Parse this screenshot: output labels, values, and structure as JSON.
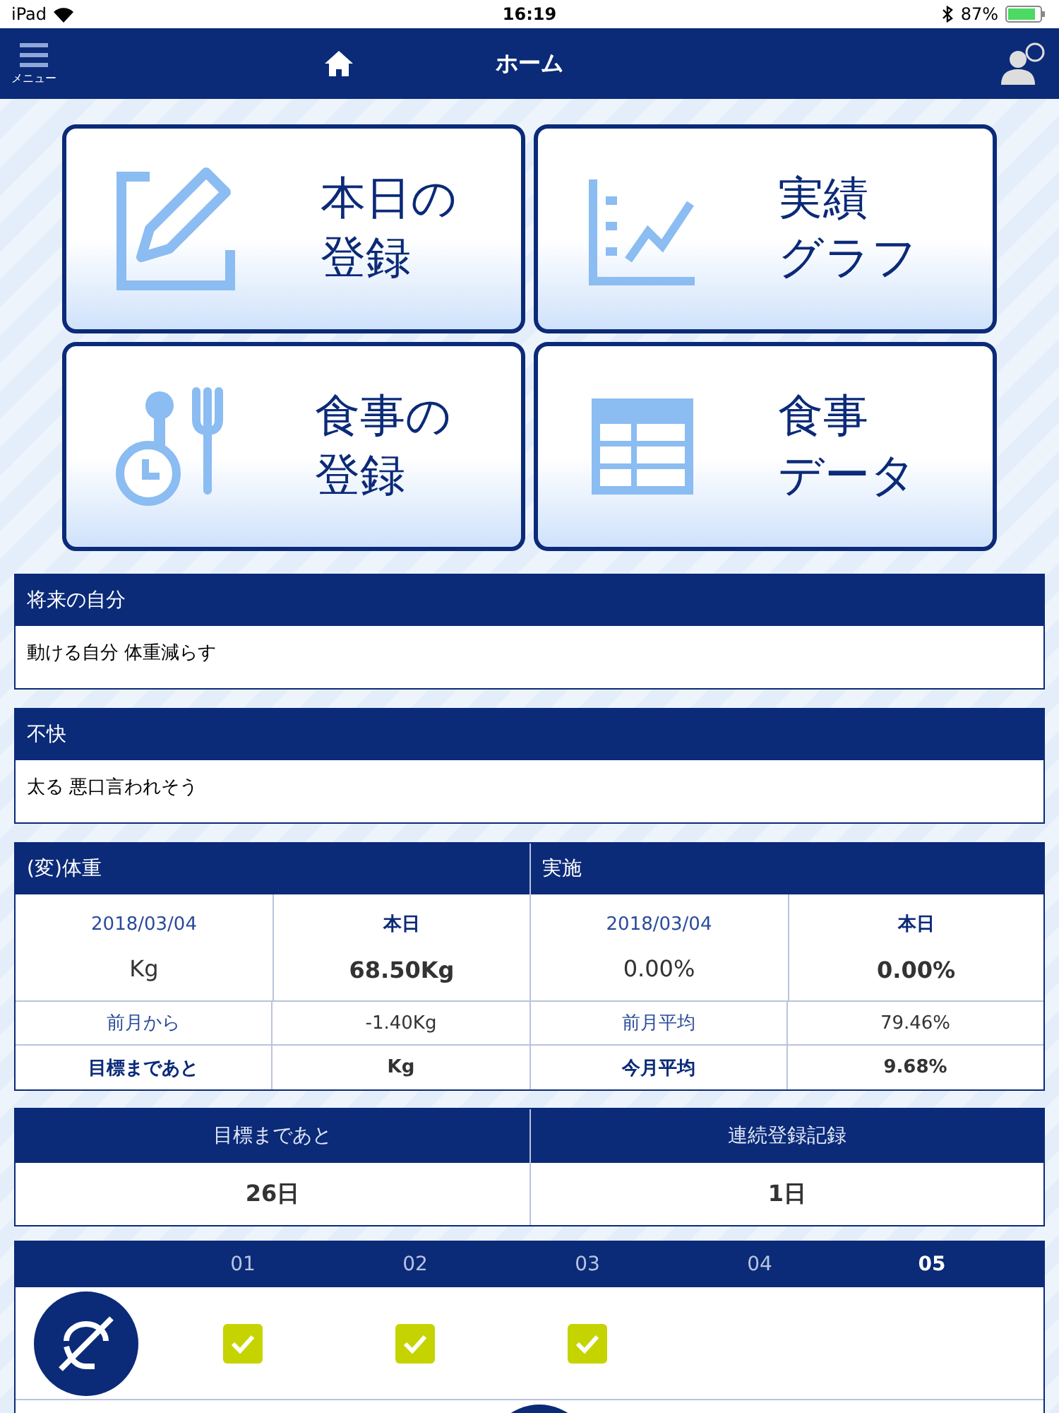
{
  "status_bar": {
    "device": "iPad",
    "time": "16:19",
    "battery": "87%"
  },
  "nav": {
    "menu_label": "メニュー",
    "title": "ホーム"
  },
  "tiles": [
    {
      "kind": "edit",
      "lines": [
        "本日の",
        "登録"
      ]
    },
    {
      "kind": "graph",
      "lines": [
        "実績",
        "グラフ"
      ]
    },
    {
      "kind": "meal",
      "lines": [
        "食事の",
        "登録"
      ]
    },
    {
      "kind": "table",
      "lines": [
        "食事",
        "データ"
      ]
    }
  ],
  "notes": [
    {
      "title": "将来の自分",
      "body": "動ける自分 体重減らす"
    },
    {
      "title": "不快",
      "body": "太る 悪口言われそう"
    }
  ],
  "stats": [
    {
      "title": "(変)体重",
      "date": "2018/03/04",
      "today_label": "本日",
      "past_value": "Kg",
      "today_value": "68.50Kg",
      "row1_label": "前月から",
      "row1_value": "-1.40Kg",
      "row2_label": "目標まであと",
      "row2_value": "Kg"
    },
    {
      "title": "実施",
      "date": "2018/03/04",
      "today_label": "本日",
      "past_value": "0.00%",
      "today_value": "0.00%",
      "row1_label": "前月平均",
      "row1_value": "79.46%",
      "row2_label": "今月平均",
      "row2_value": "9.68%"
    }
  ],
  "summary": [
    {
      "label": "目標まであと",
      "value": "26日"
    },
    {
      "label": "連続登録記録",
      "value": "1日"
    }
  ],
  "tracker": {
    "days": [
      {
        "label": "01",
        "selected": false
      },
      {
        "label": "02",
        "selected": false
      },
      {
        "label": "03",
        "selected": false
      },
      {
        "label": "04",
        "selected": false
      },
      {
        "label": "05",
        "selected": true
      }
    ],
    "rows": [
      {
        "checks": [
          true,
          true,
          true,
          false,
          false
        ]
      }
    ]
  }
}
